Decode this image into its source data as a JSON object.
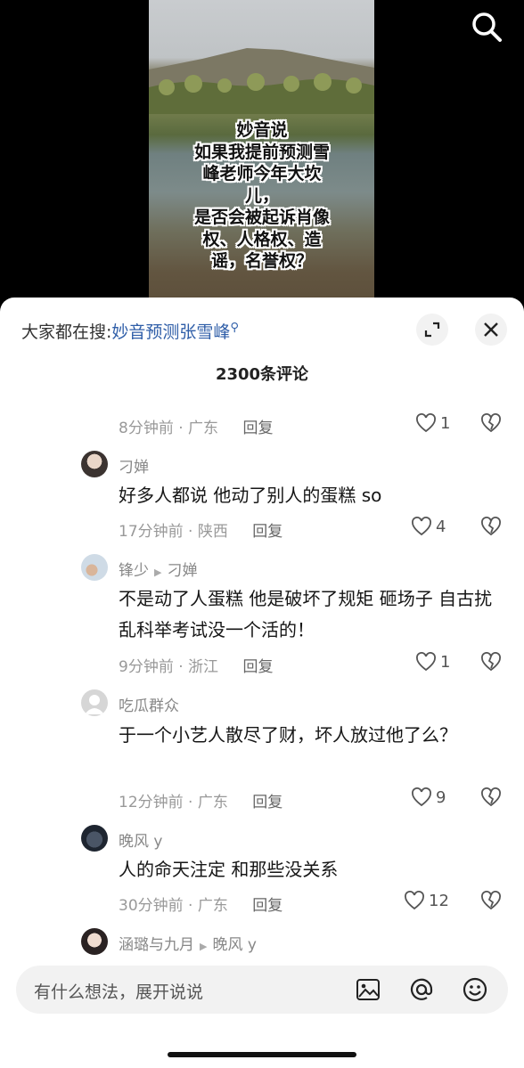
{
  "video": {
    "caption_lines": [
      "妙音说",
      "如果我提前预测雪",
      "峰老师今年大坎",
      "儿，",
      "是否会被起诉肖像",
      "权、人格权、造",
      "谣，名誉权？"
    ]
  },
  "icons": {
    "search": "search-icon",
    "expand": "expand-icon",
    "close": "close-icon",
    "heart": "heart-icon",
    "broken_heart": "broken-heart-icon",
    "image": "image-icon",
    "mention": "at-icon",
    "emoji": "emoji-icon"
  },
  "sheet": {
    "hot_search_prefix": "大家都在搜:",
    "hot_search_term": "妙音预测张雪峰",
    "count_label": "2300条评论"
  },
  "comments": [
    {
      "user": "",
      "reply_to": "",
      "text": "",
      "time": "8分钟前",
      "location": "广东",
      "reply_label": "回复",
      "likes": "1"
    },
    {
      "user": "刁婵",
      "reply_to": "",
      "text": "好多人都说 他动了别人的蛋糕 so",
      "time": "17分钟前",
      "location": "陕西",
      "reply_label": "回复",
      "likes": "4"
    },
    {
      "user": "锋少",
      "reply_to": "刁婵",
      "text": "不是动了人蛋糕 他是破坏了规矩 砸场子 自古扰乱科举考试没一个活的！",
      "time": "9分钟前",
      "location": "浙江",
      "reply_label": "回复",
      "likes": "1"
    },
    {
      "user": "吃瓜群众",
      "reply_to": "",
      "text": "于一个小艺人散尽了财，坏人放过他了么？",
      "time": "12分钟前",
      "location": "广东",
      "reply_label": "回复",
      "likes": "9"
    },
    {
      "user": "晚风 y",
      "reply_to": "",
      "text": "人的命天注定 和那些没关系",
      "time": "30分钟前",
      "location": "广东",
      "reply_label": "回复",
      "likes": "12"
    },
    {
      "user": "涵璐与九月",
      "reply_to": "晚风 y",
      "text": "",
      "time": "",
      "location": "",
      "reply_label": "",
      "likes": ""
    }
  ],
  "input": {
    "placeholder": "有什么想法，展开说说"
  },
  "colors": {
    "link_blue": "#2f5ea8",
    "meta_gray": "#999999",
    "sheet_bg": "#ffffff"
  }
}
